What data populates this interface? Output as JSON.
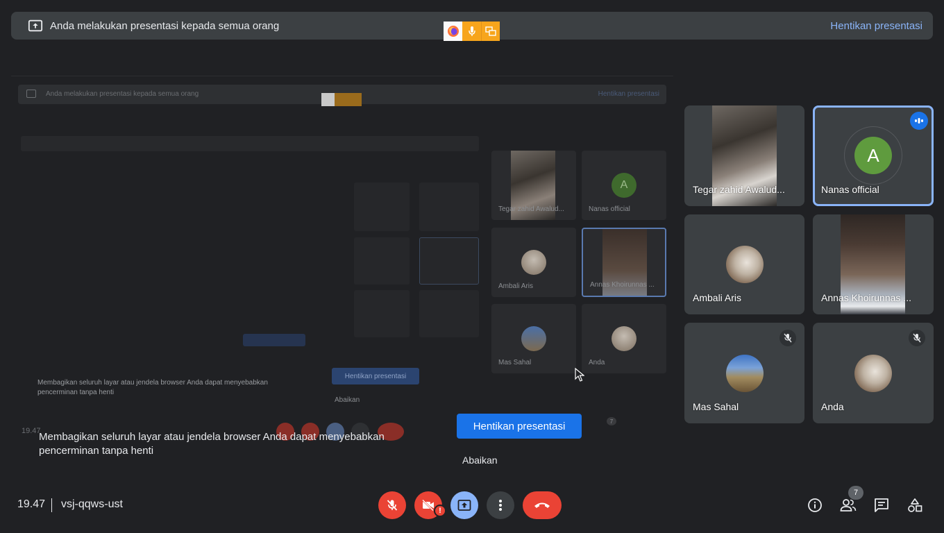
{
  "banner": {
    "text": "Anda melakukan presentasi kepada semua orang",
    "stop": "Hentikan presentasi"
  },
  "colors": {
    "accent": "#8ab4f8",
    "danger": "#ea4335",
    "primary": "#1a73e8",
    "surface": "#3c4043",
    "background": "#202124"
  },
  "share_indicator": {
    "icons": [
      "firefox-icon",
      "mic-icon",
      "window-share-icon"
    ]
  },
  "share_warning": {
    "message": "Membagikan seluruh layar atau jendela browser Anda dapat menyebabkan pencerminan tanpa henti",
    "stop_label": "Hentikan presentasi",
    "ignore_label": "Abaikan"
  },
  "mirror": {
    "banner_text": "Anda melakukan presentasi kepada semua orang",
    "banner_stop": "Hentikan presentasi",
    "message": "Membagikan seluruh layar atau jendela browser Anda dapat menyebabkan pencerminan tanpa henti",
    "stop_label": "Hentikan presentasi",
    "ignore_label": "Abaikan",
    "time": "19.47",
    "participant_count": "7",
    "tiles": [
      "Tegar zahid Awalud...",
      "Nanas official",
      "Ambali Aris",
      "Annas Khoirunnas ...",
      "Mas Sahal",
      "Anda"
    ],
    "avatar_letter": "A"
  },
  "participants": [
    {
      "name": "Tegar zahid Awalud...",
      "type": "video",
      "muted": false
    },
    {
      "name": "Nanas official",
      "type": "letter",
      "letter": "A",
      "speaking": true
    },
    {
      "name": "Ambali Aris",
      "type": "photo",
      "muted": false
    },
    {
      "name": "Annas Khoirunnas ...",
      "type": "video",
      "muted": false
    },
    {
      "name": "Mas Sahal",
      "type": "photo",
      "muted": true
    },
    {
      "name": "Anda",
      "type": "photo",
      "muted": true
    }
  ],
  "footer": {
    "time": "19.47",
    "meeting_code": "vsj-qqws-ust",
    "participant_count": "7",
    "camera_warning": "!",
    "controls": [
      "mic-off-icon",
      "camera-off-icon",
      "present-icon",
      "more-icon",
      "end-call-icon"
    ],
    "right_icons": [
      "info-icon",
      "people-icon",
      "chat-icon",
      "activities-icon"
    ]
  }
}
